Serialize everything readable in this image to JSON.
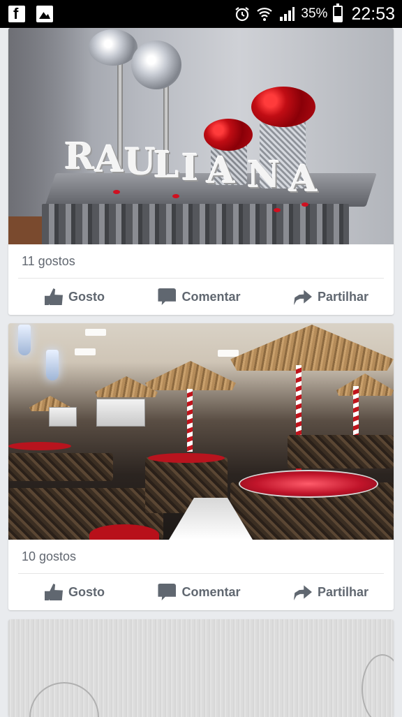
{
  "status_bar": {
    "left_icons": [
      "facebook-icon",
      "gallery-icon"
    ],
    "right_icons": [
      "alarm-icon",
      "wifi-icon",
      "signal-icon",
      "battery-icon"
    ],
    "battery_percent": "35%",
    "battery_level": 0.35,
    "time": "22:53"
  },
  "posts": [
    {
      "photo_letters": [
        "R",
        "A",
        "U",
        "L",
        "I",
        "A",
        "N",
        "A"
      ],
      "likes_text": "11 gostos",
      "actions": {
        "like": "Gosto",
        "comment": "Comentar",
        "share": "Partilhar"
      }
    },
    {
      "likes_text": "10 gostos",
      "actions": {
        "like": "Gosto",
        "comment": "Comentar",
        "share": "Partilhar"
      }
    }
  ],
  "colors": {
    "feed_background": "#e9ebee",
    "status_bar": "#000000",
    "action_text": "#606770",
    "likes_text": "#616770"
  }
}
